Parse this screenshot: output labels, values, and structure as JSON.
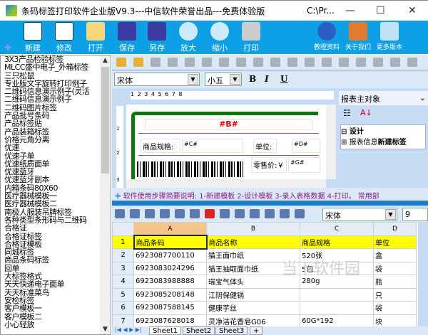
{
  "window": {
    "title": "条码标签打印软件企业版V9.3---中信软件荣誉出品---免费体验版",
    "path": "C:\\Pr...",
    "minimize": "—",
    "maximize": "☐",
    "close": "✕"
  },
  "toolbar": [
    {
      "label": "新建",
      "icon": "new-grid-icon"
    },
    {
      "label": "修改",
      "icon": "edit-pencil-icon"
    },
    {
      "label": "打开",
      "icon": "folder-icon"
    },
    {
      "label": "保存",
      "icon": "floppy-icon"
    },
    {
      "label": "另存",
      "icon": "save-as-icon"
    },
    {
      "label": "放大",
      "icon": "zoom-in-icon"
    },
    {
      "label": "缩小",
      "icon": "zoom-out-icon"
    },
    {
      "label": "打印",
      "icon": "printer-icon"
    },
    {
      "label": "教程资料",
      "icon": "help-icon"
    },
    {
      "label": "关于我们",
      "icon": "users-icon"
    },
    {
      "label": "更多版本",
      "icon": "more-versions-icon"
    }
  ],
  "colors": {
    "toolbar_bg": "#0ea0e6",
    "accent": "#1f7ad0",
    "header_yellow": "#ffff00"
  },
  "templates": [
    "3X3产品检验标签",
    "MLCC盛中电子_外箱标签",
    "三只松鼠",
    "专业版文字旋转打印例子",
    "二维码信息演示例子(灵活",
    "二维码信息演示例子",
    "二维码图片标签",
    "产品批号条码",
    "产品标签贴",
    "产品装箱标签",
    "价格元角分离",
    "优速",
    "优速子单",
    "优速纸质面单",
    "优速蓝牙",
    "优速蓝牙副本",
    "内箱条码80X60",
    "医疗器械模板一",
    "医疗器械模板二",
    "南极人服装吊牌标签",
    "各种类型条形码与二维码",
    "合格证",
    "合格证标签",
    "合格证模板",
    "同城标签",
    "商品条码标签",
    "回单",
    "大标签格式",
    "天天快递电子面单",
    "天天标准菜鸟",
    "安检标签",
    "客户模板一",
    "客户模板二",
    "小心轻放"
  ],
  "designer": {
    "font": "宋体",
    "size": "小五",
    "bold": "B",
    "italic": "I",
    "underline": "U",
    "ruler": "1    2    3    4    5    6    7    8",
    "vruler": [
      "1",
      "2",
      "3"
    ],
    "label": {
      "title_field": "#B#",
      "spec_label": "商品规格:",
      "spec_field": "#C#",
      "unit_label": "单位:",
      "unit_field": "#D#",
      "price_label": "零售价:￥",
      "price_field": "#G#"
    }
  },
  "properties": {
    "object": "报表主对象",
    "tree": [
      {
        "sign": "⊟",
        "label": "设计"
      },
      {
        "sign": "⊞",
        "label": "报表信息",
        "value": "新建标签"
      }
    ]
  },
  "info": "软件使用步骤简要说明: 1-新建模板 2-设计模板 3-录入表格数据 4-打印。 常用部",
  "grid": {
    "font": "宋体",
    "size": "9",
    "columns": [
      "A",
      "B",
      "C",
      "D"
    ],
    "rows": [
      [
        "1",
        "商品条码",
        "商品名称",
        "商品规格",
        "单位"
      ],
      [
        "2",
        "6923087700110",
        "猫王面巾纸",
        "520张",
        "盒"
      ],
      [
        "3",
        "6923083024296",
        "猫王抽取面巾纸",
        "5包",
        "袋"
      ],
      [
        "4",
        "6923083988888",
        "瑞宝气体头",
        "280g",
        "瓶"
      ],
      [
        "5",
        "6923085208148",
        "江阴保健锅",
        "",
        "只"
      ],
      [
        "6",
        "6923087588145",
        "健康芋丝",
        "",
        "袋"
      ],
      [
        "7",
        "6923087628018",
        "灵净洁花香皂G06",
        "60G*192",
        "块"
      ]
    ],
    "sheets": [
      "Sheet1",
      "Sheet2",
      "Sheet3",
      "+"
    ]
  },
  "watermark": "当下软件园"
}
